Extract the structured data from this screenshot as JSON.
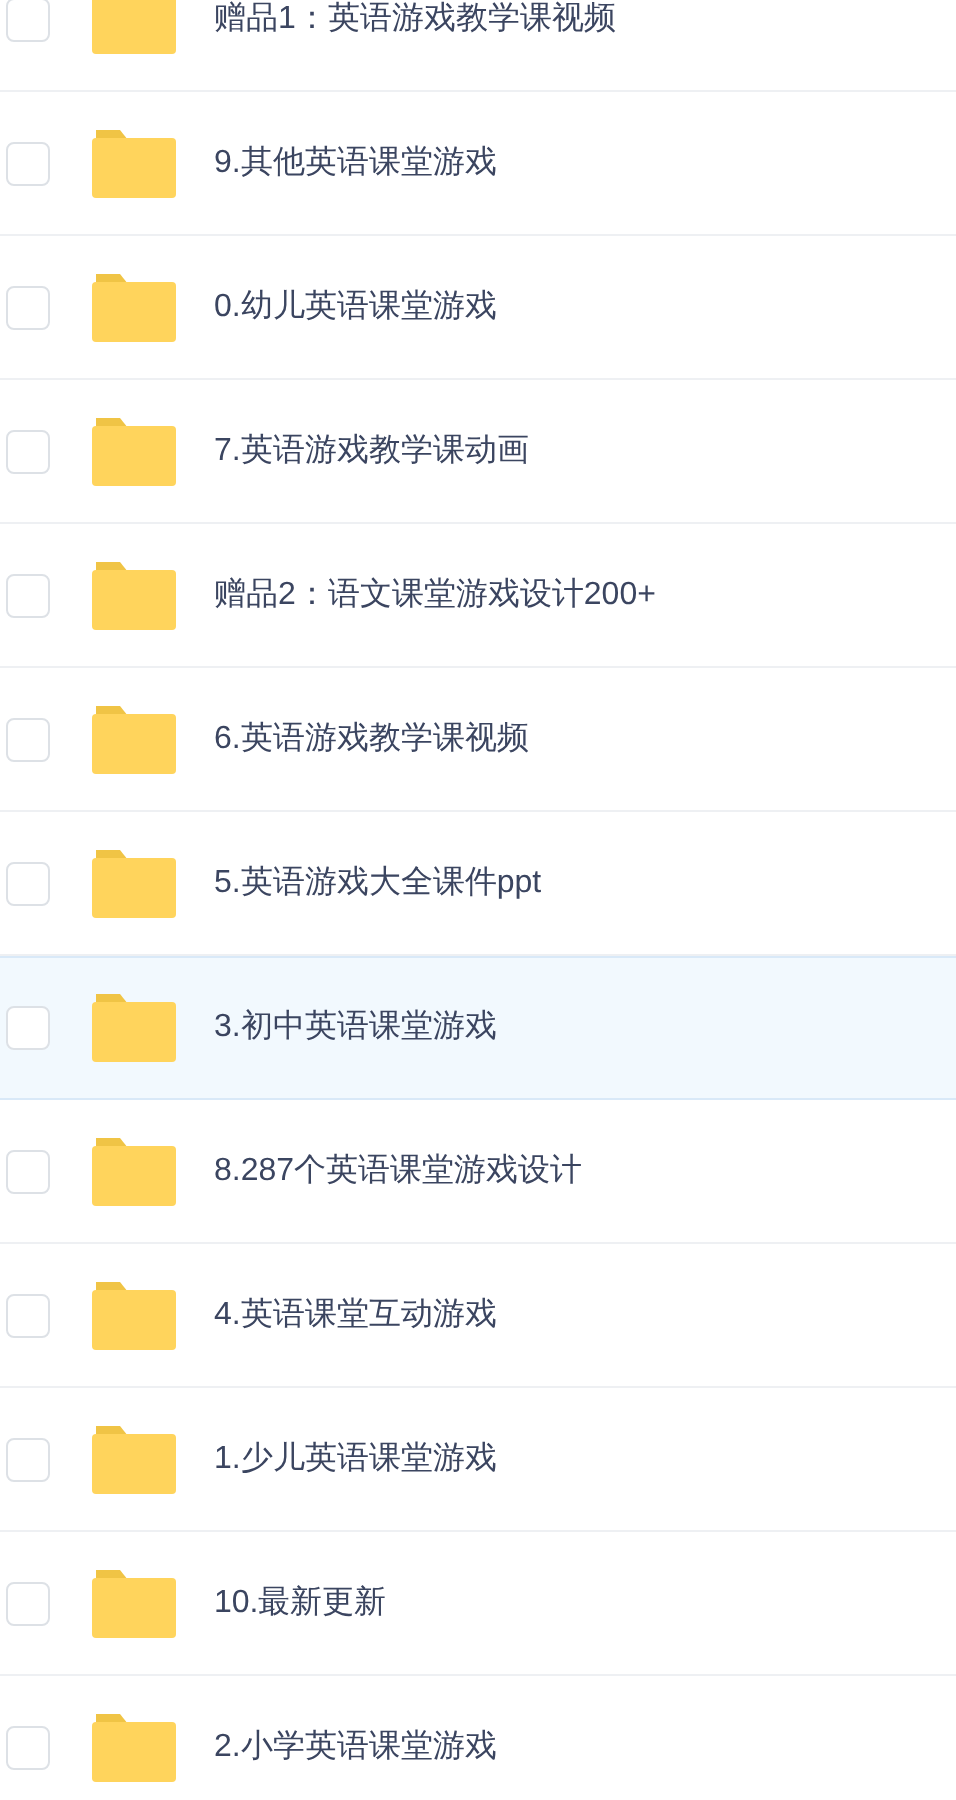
{
  "files": [
    {
      "name": "赠品1：英语游戏教学课视频",
      "checked": false,
      "selected": false
    },
    {
      "name": "9.其他英语课堂游戏",
      "checked": false,
      "selected": false
    },
    {
      "name": "0.幼儿英语课堂游戏",
      "checked": false,
      "selected": false
    },
    {
      "name": "7.英语游戏教学课动画",
      "checked": false,
      "selected": false
    },
    {
      "name": "赠品2：语文课堂游戏设计200+",
      "checked": false,
      "selected": false
    },
    {
      "name": "6.英语游戏教学课视频",
      "checked": false,
      "selected": false
    },
    {
      "name": "5.英语游戏大全课件ppt",
      "checked": false,
      "selected": false
    },
    {
      "name": "3.初中英语课堂游戏",
      "checked": false,
      "selected": true
    },
    {
      "name": "8.287个英语课堂游戏设计",
      "checked": false,
      "selected": false
    },
    {
      "name": "4.英语课堂互动游戏",
      "checked": false,
      "selected": false
    },
    {
      "name": "1.少儿英语课堂游戏",
      "checked": false,
      "selected": false
    },
    {
      "name": "10.最新更新",
      "checked": false,
      "selected": false
    },
    {
      "name": "2.小学英语课堂游戏",
      "checked": false,
      "selected": false
    }
  ]
}
